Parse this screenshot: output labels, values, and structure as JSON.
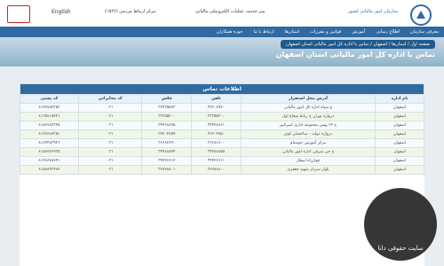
{
  "header": {
    "language": "English",
    "call_center": "مرکز ارتباط مردمی (۱۵۲۶)",
    "portal": "میز خدمت عملیات الکترونیکی مالیاتی",
    "org_name": "سازمان امور مالیاتی کشور"
  },
  "nav": [
    "معرفی سازمان",
    "اطلاع رسانی",
    "آموزش",
    "قوانین و مقررات",
    "استان‌ها",
    "ارتباط با ما",
    "حوزه همکاران"
  ],
  "breadcrumb": "صفحه اول / استان‌ها / اصفهان / تماس با اداره کل امور مالیاتی استان اصفهان",
  "banner_title": "تماس با اداره کل امور مالیاتی استان اصفهان",
  "table_title": "اطلاعات تماس",
  "columns": [
    "نام اداره",
    "آدرس محل استقرار",
    "تلفن",
    "فکس",
    "کد مخابراتی",
    "کد پستی"
  ],
  "rows": [
    [
      "اصفهان",
      "چ سپاه اداره کل امور مالیاتی",
      "۳۲۲۰۸۹۷۰",
      "۳۲۲۳۵۵۷۳",
      "۰۳۱",
      "۸۱۴۷۷۸۴۳۵۳"
    ],
    [
      "اصفهان",
      "دروازه تهران خ رباط شعاع اول",
      "۳۳۳۵۵۳۰۰",
      "۳۳۳۵۵۳۰۰",
      "۰۳۱",
      "۸۱۳۵۷۱۵۴۲۱"
    ],
    [
      "اصفهان",
      "خ ۲۲ بهمن مجموعه اداری امیرکبیر",
      "۳۴۴۲۸۸۶۱",
      "۳۴۴۶۸۸۹۵",
      "۰۳۱",
      "۸۱۵۶۷۸۴۳۴۵"
    ],
    [
      "اصفهان",
      "دروازه دولت - ساختمان کوثر",
      "۳۲۲۰۴۷۵۰",
      "۳۲۲۰۴۷۵۹",
      "۰۳۱",
      "۸۱۳۷۶۸۷۳۵۱"
    ],
    [
      "اصفهان",
      "مرکز آموزش خوشنام",
      "۳۶۶۸۱۷۰۰",
      "۳۶۶۸۳۸۹۰",
      "۰۳۱",
      "۸۱۸۴۴۸۳۹۳۶"
    ],
    [
      "اصفهان",
      "خ جی شرقی اداره امور مالیاتی",
      "۳۴۴۸۸۸۵۵",
      "۳۴۴۸۸۸۴۴",
      "۰۳۱",
      "۸۱۵۸۷۷۶۹۳۵"
    ],
    [
      "اصفهان",
      "چهارراه ابیطار",
      "۳۴۴۲۶۶۱۱",
      "۳۴۴۲۶۶۱۲",
      "۰۳۱",
      "۸۱۴۸۶۷۸۷۴۱"
    ],
    [
      "اصفهان",
      "بلوار سردار شهید جعفری",
      "۳۷۷۷۸۸۰۰",
      "۳۷۷۷۸۸۰۱",
      "۰۳۱",
      "۸۱۵۸۷۴۳۴۸۲"
    ]
  ],
  "watermark": "سایت حقوقی دانا"
}
